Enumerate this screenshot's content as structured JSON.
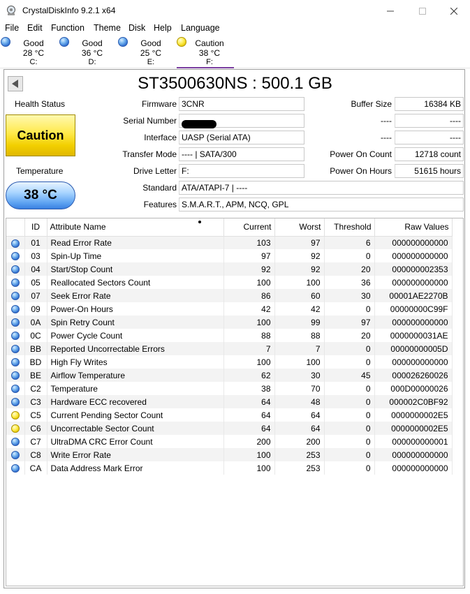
{
  "window": {
    "title": "CrystalDiskInfo 9.2.1 x64"
  },
  "menu": [
    "File",
    "Edit",
    "Function",
    "Theme",
    "Disk",
    "Help",
    "Language"
  ],
  "drives": [
    {
      "status": "Good",
      "temp": "28 °C",
      "letter": "C:",
      "color": "blue"
    },
    {
      "status": "Good",
      "temp": "36 °C",
      "letter": "D:",
      "color": "blue"
    },
    {
      "status": "Good",
      "temp": "25 °C",
      "letter": "E:",
      "color": "blue"
    },
    {
      "status": "Caution",
      "temp": "38 °C",
      "letter": "F:",
      "color": "yellow"
    }
  ],
  "disk": {
    "title": "ST3500630NS : 500.1 GB",
    "health_label": "Health Status",
    "health_value": "Caution",
    "temp_label": "Temperature",
    "temp_value": "38 °C",
    "labels": {
      "firmware": "Firmware",
      "serial": "Serial Number",
      "interface": "Interface",
      "transfer_mode": "Transfer Mode",
      "drive_letter": "Drive Letter",
      "standard": "Standard",
      "features": "Features",
      "buffer_size": "Buffer Size",
      "power_on_count": "Power On Count",
      "power_on_hours": "Power On Hours",
      "blank1": "----",
      "blank2": "----"
    },
    "values": {
      "firmware": "3CNR",
      "serial": "",
      "interface": "UASP (Serial ATA)",
      "transfer_mode": "---- | SATA/300",
      "drive_letter": "F:",
      "standard": "ATA/ATAPI-7 | ----",
      "features": "S.M.A.R.T., APM, NCQ, GPL",
      "buffer_size": "16384 KB",
      "blank1": "----",
      "blank2": "----",
      "power_on_count": "12718 count",
      "power_on_hours": "51615 hours"
    }
  },
  "table": {
    "headers": {
      "id": "ID",
      "name": "Attribute Name",
      "current": "Current",
      "worst": "Worst",
      "threshold": "Threshold",
      "raw": "Raw Values"
    },
    "rows": [
      {
        "color": "blue",
        "id": "01",
        "name": "Read Error Rate",
        "current": "103",
        "worst": "97",
        "threshold": "6",
        "raw": "000000000000"
      },
      {
        "color": "blue",
        "id": "03",
        "name": "Spin-Up Time",
        "current": "97",
        "worst": "92",
        "threshold": "0",
        "raw": "000000000000"
      },
      {
        "color": "blue",
        "id": "04",
        "name": "Start/Stop Count",
        "current": "92",
        "worst": "92",
        "threshold": "20",
        "raw": "000000002353"
      },
      {
        "color": "blue",
        "id": "05",
        "name": "Reallocated Sectors Count",
        "current": "100",
        "worst": "100",
        "threshold": "36",
        "raw": "000000000000"
      },
      {
        "color": "blue",
        "id": "07",
        "name": "Seek Error Rate",
        "current": "86",
        "worst": "60",
        "threshold": "30",
        "raw": "00001AE2270B"
      },
      {
        "color": "blue",
        "id": "09",
        "name": "Power-On Hours",
        "current": "42",
        "worst": "42",
        "threshold": "0",
        "raw": "00000000C99F"
      },
      {
        "color": "blue",
        "id": "0A",
        "name": "Spin Retry Count",
        "current": "100",
        "worst": "99",
        "threshold": "97",
        "raw": "000000000000"
      },
      {
        "color": "blue",
        "id": "0C",
        "name": "Power Cycle Count",
        "current": "88",
        "worst": "88",
        "threshold": "20",
        "raw": "0000000031AE"
      },
      {
        "color": "blue",
        "id": "BB",
        "name": "Reported Uncorrectable Errors",
        "current": "7",
        "worst": "7",
        "threshold": "0",
        "raw": "00000000005D"
      },
      {
        "color": "blue",
        "id": "BD",
        "name": "High Fly Writes",
        "current": "100",
        "worst": "100",
        "threshold": "0",
        "raw": "000000000000"
      },
      {
        "color": "blue",
        "id": "BE",
        "name": "Airflow Temperature",
        "current": "62",
        "worst": "30",
        "threshold": "45",
        "raw": "000026260026"
      },
      {
        "color": "blue",
        "id": "C2",
        "name": "Temperature",
        "current": "38",
        "worst": "70",
        "threshold": "0",
        "raw": "000D00000026"
      },
      {
        "color": "blue",
        "id": "C3",
        "name": "Hardware ECC recovered",
        "current": "64",
        "worst": "48",
        "threshold": "0",
        "raw": "000002C0BF92"
      },
      {
        "color": "yellow",
        "id": "C5",
        "name": "Current Pending Sector Count",
        "current": "64",
        "worst": "64",
        "threshold": "0",
        "raw": "0000000002E5"
      },
      {
        "color": "yellow",
        "id": "C6",
        "name": "Uncorrectable Sector Count",
        "current": "64",
        "worst": "64",
        "threshold": "0",
        "raw": "0000000002E5"
      },
      {
        "color": "blue",
        "id": "C7",
        "name": "UltraDMA CRC Error Count",
        "current": "200",
        "worst": "200",
        "threshold": "0",
        "raw": "000000000001"
      },
      {
        "color": "blue",
        "id": "C8",
        "name": "Write Error Rate",
        "current": "100",
        "worst": "253",
        "threshold": "0",
        "raw": "000000000000"
      },
      {
        "color": "blue",
        "id": "CA",
        "name": "Data Address Mark Error",
        "current": "100",
        "worst": "253",
        "threshold": "0",
        "raw": "000000000000"
      }
    ]
  }
}
